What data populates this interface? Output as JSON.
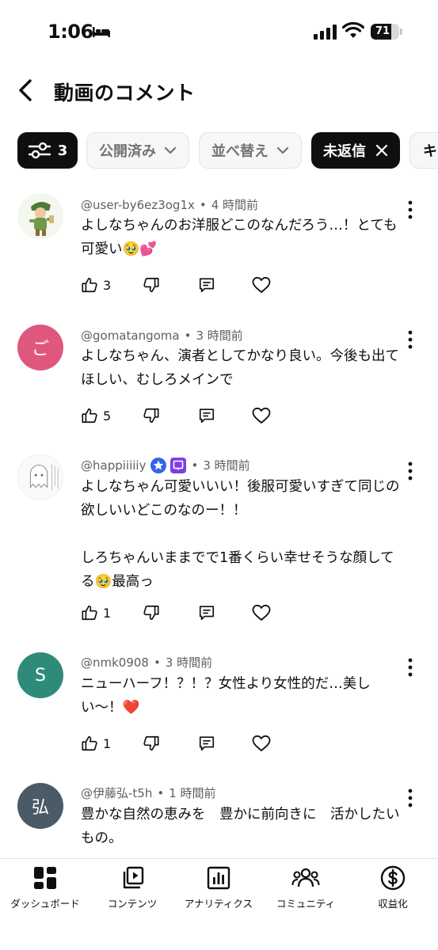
{
  "status_bar": {
    "time": "1:06",
    "battery": "71",
    "battery_level": 0.71
  },
  "header": {
    "title": "動画のコメント"
  },
  "chips": {
    "filter_count": "3",
    "published": "公開済み",
    "sort": "並べ替え",
    "unreplied": "未返信",
    "overflow": "キ"
  },
  "comments": [
    {
      "author": "@user-by6ez3og1x",
      "separator": "•",
      "time": "4 時間前",
      "text": "よしなちゃんのお洋服どこのなんだろう…！とても可愛い🥹💕",
      "likes": "3"
    },
    {
      "author": "@gomatangoma",
      "separator": "•",
      "time": "3 時間前",
      "avatar_letter": "ご",
      "avatar_color": "#e0577e",
      "text": "よしなちゃん、演者としてかなり良い。今後も出てほしい、むしろメインで",
      "likes": "5"
    },
    {
      "author": "@happiiiiiy",
      "separator": "•",
      "time": "3 時間前",
      "text": "よしなちゃん可愛いいい！後服可愛いすぎて同じの欲しいいどこのなのー！！\n\nしろちゃんいままでで1番くらい幸せそうな顔してる🥹最高っ",
      "likes": "1"
    },
    {
      "author": "@nmk0908",
      "separator": "•",
      "time": "3 時間前",
      "avatar_letter": "S",
      "avatar_color": "#2e8b7a",
      "text": "ニューハーフ！？！？女性より女性的だ…美しい〜！❤️",
      "likes": "1"
    },
    {
      "author": "@伊藤弘-t5h",
      "separator": "•",
      "time": "1 時間前",
      "avatar_letter": "弘",
      "avatar_color": "#4a5a66",
      "text": "豊かな自然の恵みを　豊かに前向きに　活かしたいもの。"
    }
  ],
  "bottom_nav": [
    {
      "label": "ダッシュボード"
    },
    {
      "label": "コンテンツ"
    },
    {
      "label": "アナリティクス"
    },
    {
      "label": "コミュニティ"
    },
    {
      "label": "収益化"
    }
  ]
}
